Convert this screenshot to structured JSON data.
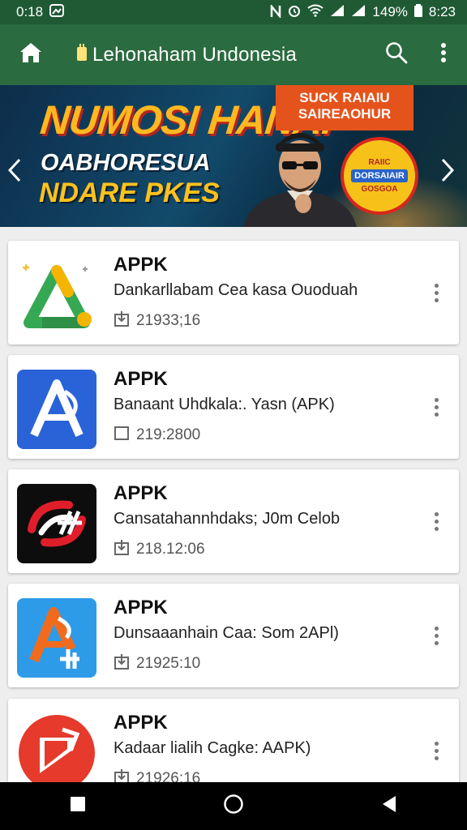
{
  "status_bar": {
    "time_left": "0:18",
    "battery": "149%",
    "time_right": "8:23"
  },
  "app_bar": {
    "title": "Lehonaham Undonesia",
    "home_icon": "home-icon",
    "search_icon": "search-icon",
    "menu_icon": "more-vert-icon"
  },
  "banner": {
    "headline": "NUMOSI HANAI",
    "subline1": "OABHORESUA",
    "subline2": "NDARE PKES",
    "promo_line1": "SUCK RAIAIU",
    "promo_line2": "SAIREAOHUR",
    "badge_top": "RAIIC",
    "badge_mid": "DORSAIAIR",
    "badge_bottom": "GOSGOA",
    "prev_icon": "chevron-left-icon",
    "next_icon": "chevron-right-icon",
    "colors": {
      "headline": "#ffb820",
      "accent": "#e5531c"
    }
  },
  "apps": [
    {
      "name": "APPK",
      "description": "Dankarllabam Cea kasa Ouoduah",
      "meta": "21933;16",
      "icon": "green-a-triangle-icon"
    },
    {
      "name": "APPK",
      "description": "Banaant Uhdkala:. Yasn (APK)",
      "meta": "219:2800",
      "icon": "blue-a-icon"
    },
    {
      "name": "APPK",
      "description": "Cansatahannhdaks; J0m Celob",
      "meta": "218.12:06",
      "icon": "black-red-swirl-icon"
    },
    {
      "name": "APPK",
      "description": "Dunsaaanhain Caa: Som 2APl)",
      "meta": "21925:10",
      "icon": "blue-orange-a-icon"
    },
    {
      "name": "APPK",
      "description": "Kadaar lialih Cagke: AAPK)",
      "meta": "21926:16",
      "icon": "red-circle-icon"
    }
  ],
  "nav_bar": {
    "recents_icon": "square-icon",
    "home_icon": "circle-icon",
    "back_icon": "triangle-back-icon"
  }
}
